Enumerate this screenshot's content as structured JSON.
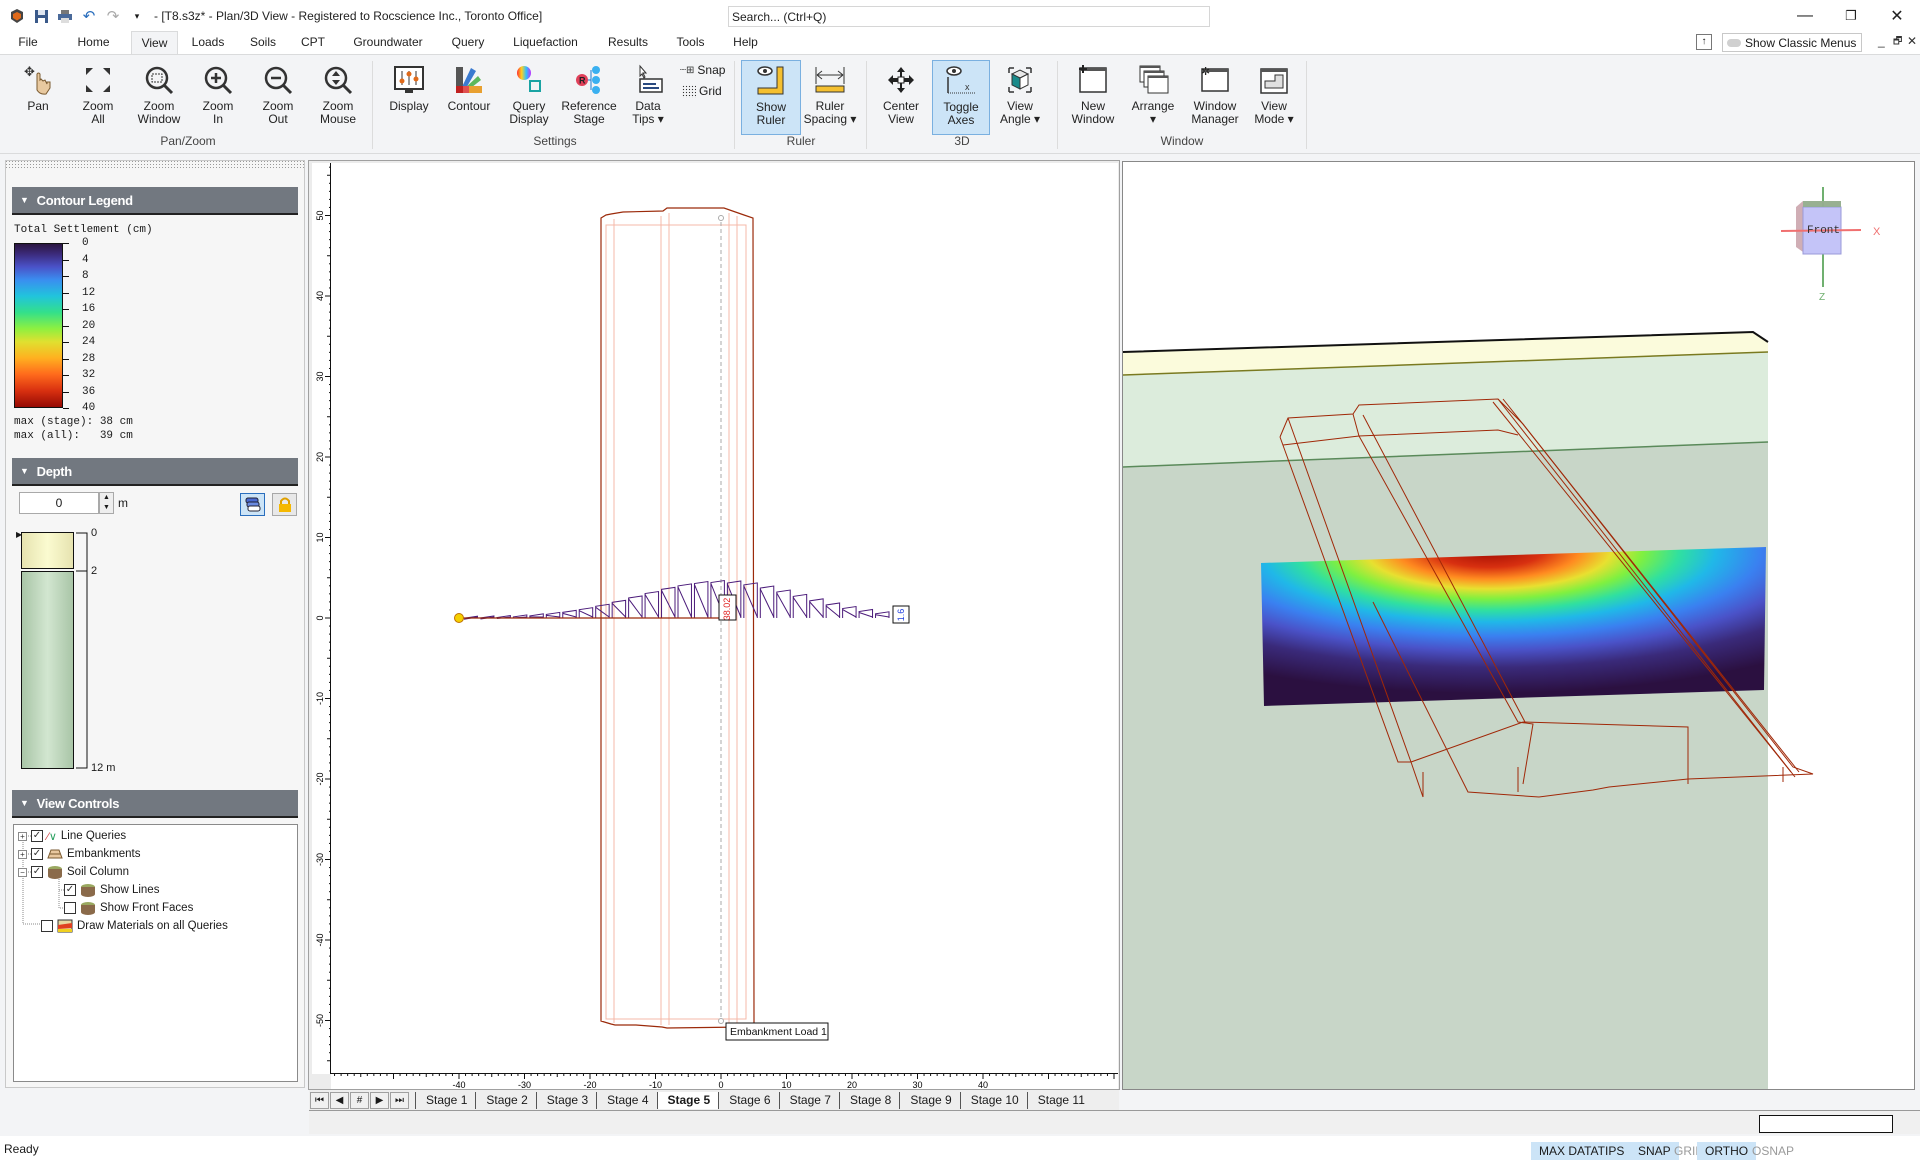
{
  "titlebar": {
    "title": "- [T8.s3z* - Plan/3D View - Registered to Rocscience Inc., Toronto Office]",
    "search_placeholder": "Search... (Ctrl+Q)",
    "qat_icons": [
      "app-logo-icon",
      "save-icon",
      "print-icon",
      "undo-icon",
      "redo-icon",
      "customize-qat-icon"
    ]
  },
  "menu": {
    "tabs": [
      "File",
      "Home",
      "View",
      "Loads",
      "Soils",
      "CPT",
      "Groundwater",
      "Query",
      "Liquefaction",
      "Results",
      "Tools",
      "Help"
    ],
    "active": "View",
    "show_classic_menus": "Show Classic Menus"
  },
  "ribbon": {
    "buttons": {
      "pan": "Pan",
      "zoom_all": "Zoom\nAll",
      "zoom_window": "Zoom\nWindow",
      "zoom_in": "Zoom\nIn",
      "zoom_out": "Zoom\nOut",
      "zoom_mouse": "Zoom\nMouse",
      "display": "Display",
      "contour": "Contour",
      "query_display": "Query\nDisplay",
      "reference_stage": "Reference\nStage",
      "data_tips": "Data\nTips ▾",
      "snap": "Snap",
      "grid": "Grid",
      "show_ruler": "Show\nRuler",
      "ruler_spacing": "Ruler\nSpacing ▾",
      "center_view": "Center\nView",
      "toggle_axes": "Toggle\nAxes",
      "view_angle": "View\nAngle ▾",
      "new_window": "New\nWindow",
      "arrange": "Arrange\n▾",
      "window_manager": "Window\nManager",
      "view_mode": "View\nMode ▾"
    },
    "groups": {
      "pan_zoom": "Pan/Zoom",
      "settings": "Settings",
      "ruler": "Ruler",
      "three_d": "3D",
      "window": "Window"
    }
  },
  "contour_legend": {
    "header": "Contour Legend",
    "title": "Total Settlement (cm)",
    "labels": [
      "0",
      "4",
      "8",
      "12",
      "16",
      "20",
      "24",
      "28",
      "32",
      "36",
      "40"
    ],
    "max_stage": "max (stage): 38 cm",
    "max_all": "max (all):   39 cm"
  },
  "depth": {
    "header": "Depth",
    "value": "0",
    "unit": "m",
    "marks": [
      "0",
      "2",
      "12 m"
    ]
  },
  "view_controls": {
    "header": "View Controls",
    "items": [
      {
        "label": "Line Queries",
        "checked": true
      },
      {
        "label": "Embankments",
        "checked": true
      },
      {
        "label": "Soil Column",
        "checked": true
      },
      {
        "label": "Show Lines",
        "checked": true
      },
      {
        "label": "Show Front Faces",
        "checked": false
      },
      {
        "label": "Draw Materials on all Queries",
        "checked": false
      }
    ]
  },
  "plan_view": {
    "v_ruler_labels": [
      "50",
      "40",
      "30",
      "20",
      "10",
      "0",
      "-10",
      "-20",
      "-30",
      "-40",
      "-50"
    ],
    "h_ruler_labels": [
      "-40",
      "-30",
      "-20",
      "-10",
      "0",
      "10",
      "20",
      "30",
      "40"
    ],
    "query_max_label": "38.02",
    "query_end_label": "1.6",
    "embankment_label": "Embankment Load 1"
  },
  "stages": {
    "tabs": [
      "Stage 1",
      "Stage 2",
      "Stage 3",
      "Stage 4",
      "Stage 5",
      "Stage 6",
      "Stage 7",
      "Stage 8",
      "Stage 9",
      "Stage 10",
      "Stage 11"
    ],
    "active": "Stage 5",
    "nav": [
      "⏮",
      "◀",
      "#",
      "▶",
      "⏭"
    ]
  },
  "view3d": {
    "cube_face": "Front",
    "axis_x": "X",
    "axis_z": "Z"
  },
  "status": {
    "text": "Ready",
    "toggles": [
      {
        "label": "MAX DATATIPS",
        "on": true
      },
      {
        "label": "SNAP",
        "on": true
      },
      {
        "label": "GRID",
        "on": false
      },
      {
        "label": "ORTHO",
        "on": true
      },
      {
        "label": "OSNAP",
        "on": false
      }
    ]
  },
  "colors": {
    "panel_header": "#727880",
    "pressed_button": "#cce4f7",
    "embankment_line": "#9b2a0a",
    "query_line": "#4b1b7a"
  }
}
